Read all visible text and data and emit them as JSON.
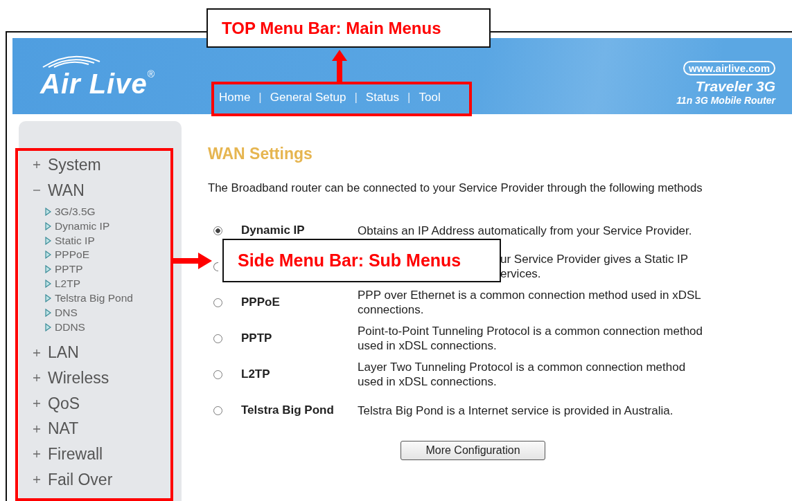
{
  "header": {
    "logo": "Air Live",
    "logo_mark": "®",
    "nav": [
      {
        "kind": "link",
        "label": "Home"
      },
      {
        "kind": "separator",
        "label": "|"
      },
      {
        "kind": "link",
        "label": "General Setup"
      },
      {
        "kind": "separator",
        "label": "|"
      },
      {
        "kind": "link",
        "label": "Status"
      },
      {
        "kind": "separator",
        "label": "|"
      },
      {
        "kind": "link",
        "label": "Tool"
      }
    ],
    "website": "www.airlive.com",
    "product": "Traveler 3G",
    "product_subtitle": "11n 3G Mobile Router"
  },
  "sidebar": {
    "items": [
      {
        "label": "System",
        "expanded": false
      },
      {
        "label": "WAN",
        "expanded": true,
        "children": [
          {
            "label": "3G/3.5G"
          },
          {
            "label": "Dynamic IP"
          },
          {
            "label": "Static IP"
          },
          {
            "label": "PPPoE"
          },
          {
            "label": "PPTP"
          },
          {
            "label": "L2TP"
          },
          {
            "label": "Telstra Big Pond"
          },
          {
            "label": "DNS"
          },
          {
            "label": "DDNS"
          }
        ]
      },
      {
        "label": "LAN",
        "expanded": false
      },
      {
        "label": "Wireless",
        "expanded": false
      },
      {
        "label": "QoS",
        "expanded": false
      },
      {
        "label": "NAT",
        "expanded": false
      },
      {
        "label": "Firewall",
        "expanded": false
      },
      {
        "label": "Fail Over",
        "expanded": false
      }
    ]
  },
  "main": {
    "title": "WAN Settings",
    "intro": "The Broadband router can be connected to your Service Provider through the following methods",
    "options": [
      {
        "kind": "normal",
        "label": "Dynamic IP",
        "description": "Obtains an IP Address automatically from your Service Provider.",
        "selected": true
      },
      {
        "kind": "covered",
        "description_lines": [
          "ur Service Provider gives a Static IP",
          "ervices."
        ],
        "selected": false
      },
      {
        "kind": "normal",
        "label": "PPPoE",
        "description": "PPP over Ethernet is a common connection method used in xDSL connections.",
        "selected": false
      },
      {
        "kind": "normal",
        "label": "PPTP",
        "description": "Point-to-Point Tunneling Protocol is a common connection method used in xDSL connections.",
        "selected": false
      },
      {
        "kind": "normal",
        "label": "L2TP",
        "description": "Layer Two Tunneling Protocol is a common connection method used in xDSL connections.",
        "selected": false
      },
      {
        "kind": "normal",
        "label": "Telstra Big Pond",
        "description": "Telstra Big Pond is a Internet service is provided in Australia.",
        "selected": false
      }
    ],
    "button": "More Configuration"
  },
  "annotations": [
    {
      "kind": "top",
      "text": "TOP Menu Bar: Main Menus"
    },
    {
      "kind": "side",
      "text": "Side Menu Bar: Sub Menus"
    }
  ]
}
